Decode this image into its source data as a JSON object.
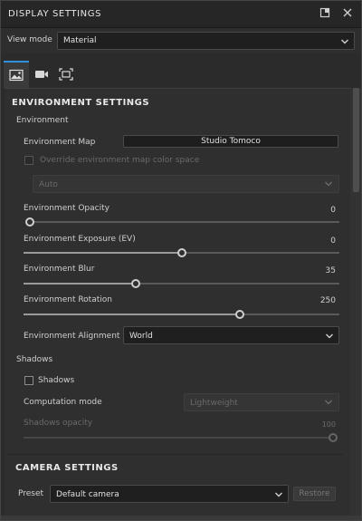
{
  "panel": {
    "title": "DISPLAY SETTINGS",
    "icons": [
      "maximize-icon",
      "close-icon"
    ]
  },
  "view_mode": {
    "label": "View mode",
    "value": "Material"
  },
  "tabs": [
    {
      "name": "environment-tab",
      "icon": "landscape-icon",
      "active": true
    },
    {
      "name": "camera-tab",
      "icon": "video-camera-icon",
      "active": false
    },
    {
      "name": "frame-tab",
      "icon": "frame-icon",
      "active": false
    }
  ],
  "environment_settings": {
    "heading": "ENVIRONMENT SETTINGS",
    "group_label": "Environment",
    "environment_map": {
      "label": "Environment Map",
      "value": "Studio Tomoco"
    },
    "override_color_space": {
      "label": "Override environment map color space",
      "checked": false,
      "enabled": false
    },
    "color_space": {
      "value": "Auto",
      "enabled": false
    },
    "opacity": {
      "label": "Environment Opacity",
      "value": "0",
      "fraction": 0.0
    },
    "exposure": {
      "label": "Environment Exposure (EV)",
      "value": "0",
      "fraction": 0.5
    },
    "blur": {
      "label": "Environment Blur",
      "value": "35",
      "fraction": 0.35
    },
    "rotation": {
      "label": "Environment Rotation",
      "value": "250",
      "fraction": 0.694
    },
    "alignment": {
      "label": "Environment Alignment",
      "value": "World"
    }
  },
  "shadows": {
    "group_label": "Shadows",
    "checkbox_label": "Shadows",
    "checked": false,
    "computation_mode": {
      "label": "Computation mode",
      "value": "Lightweight",
      "enabled": false
    },
    "opacity": {
      "label": "Shadows opacity",
      "value": "100",
      "fraction": 1.0,
      "enabled": false
    }
  },
  "camera_settings": {
    "heading": "CAMERA SETTINGS",
    "preset": {
      "label": "Preset",
      "value": "Default camera"
    },
    "restore_label": "Restore"
  },
  "colors": {
    "accent": "#2f8fdd",
    "panel_bg": "#2f2f2f",
    "title_bg": "#262626"
  }
}
